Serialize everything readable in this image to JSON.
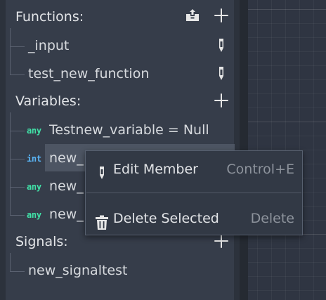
{
  "functions": {
    "header": "Functions:",
    "items": [
      {
        "label": "_input"
      },
      {
        "label": "test_new_function"
      }
    ]
  },
  "variables": {
    "header": "Variables:",
    "items": [
      {
        "type": "any",
        "label": "Testnew_variable = Null"
      },
      {
        "type": "int",
        "label": "new_"
      },
      {
        "type": "any",
        "label": "new_"
      },
      {
        "type": "any",
        "label": "new_"
      }
    ]
  },
  "signals": {
    "header": "Signals:",
    "items": [
      {
        "label": "new_signaltest"
      }
    ]
  },
  "context_menu": {
    "items": [
      {
        "label": "Edit Member",
        "shortcut": "Control+E",
        "icon": "edit-icon"
      },
      {
        "label": "Delete Selected",
        "shortcut": "Delete",
        "icon": "trash-icon"
      }
    ]
  },
  "colors": {
    "any_type": "#41e2a8",
    "int_type": "#5ab5f5",
    "panel_bg": "#363d4a",
    "selection": "#4d5563"
  }
}
